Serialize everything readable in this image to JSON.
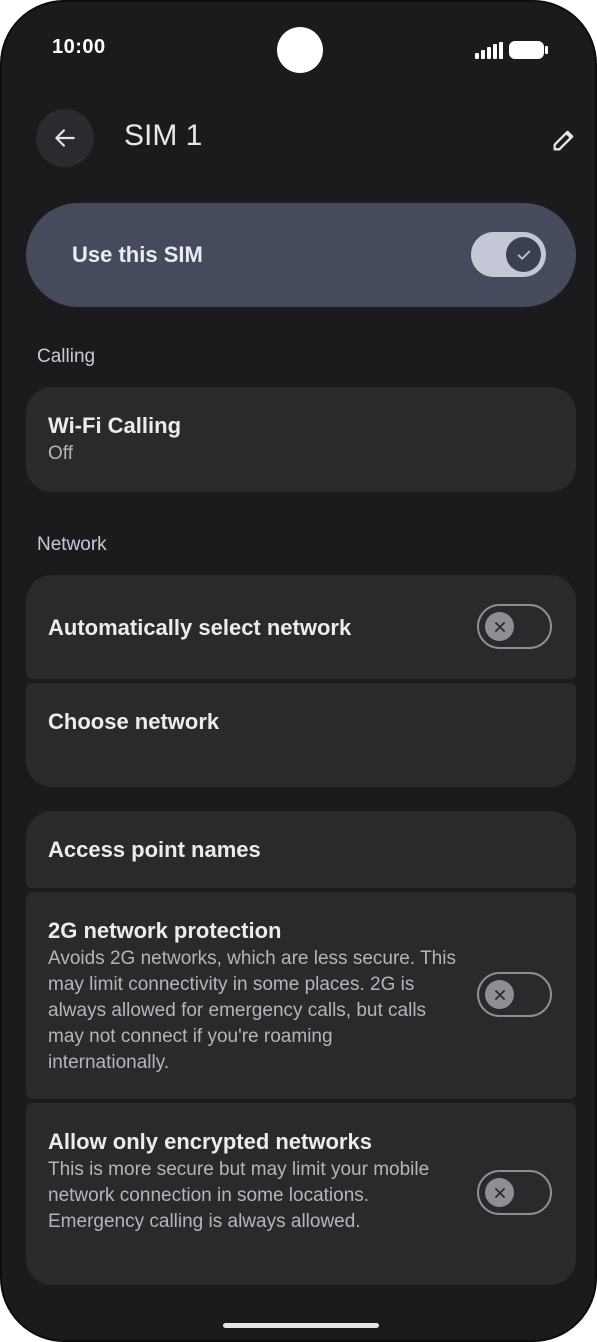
{
  "status_bar": {
    "time": "10:00"
  },
  "header": {
    "title": "SIM 1"
  },
  "master_toggle": {
    "label": "Use this SIM",
    "enabled": true
  },
  "sections": {
    "calling": "Calling",
    "network": "Network"
  },
  "wifi_calling": {
    "title": "Wi-Fi Calling",
    "value": "Off"
  },
  "auto_select": {
    "title": "Automatically select network",
    "enabled": false
  },
  "choose_network": {
    "title": "Choose network"
  },
  "apn": {
    "title": "Access point names"
  },
  "protection_2g": {
    "title": "2G network protection",
    "description": "Avoids 2G networks, which are less secure. This may limit connectivity in some places. 2G is always allowed for emergency calls, but calls may not connect if you're roaming internationally.",
    "enabled": false
  },
  "encrypted": {
    "title": "Allow only encrypted networks",
    "description": "This is more secure but may limit your mobile network connection in some locations. Emergency calling is always allowed.",
    "enabled": false
  },
  "icons": {
    "back": "arrow-back-icon",
    "edit": "pencil-icon",
    "signal": "cellular-signal-icon",
    "battery": "battery-icon",
    "check": "check-icon",
    "close": "close-icon"
  },
  "colors": {
    "background": "#1b1b1d",
    "card": "#2a2a2d",
    "master_card": "#454b5c",
    "toggle_on_track": "#c4c7d6",
    "toggle_off_outline": "#8e8e94"
  }
}
